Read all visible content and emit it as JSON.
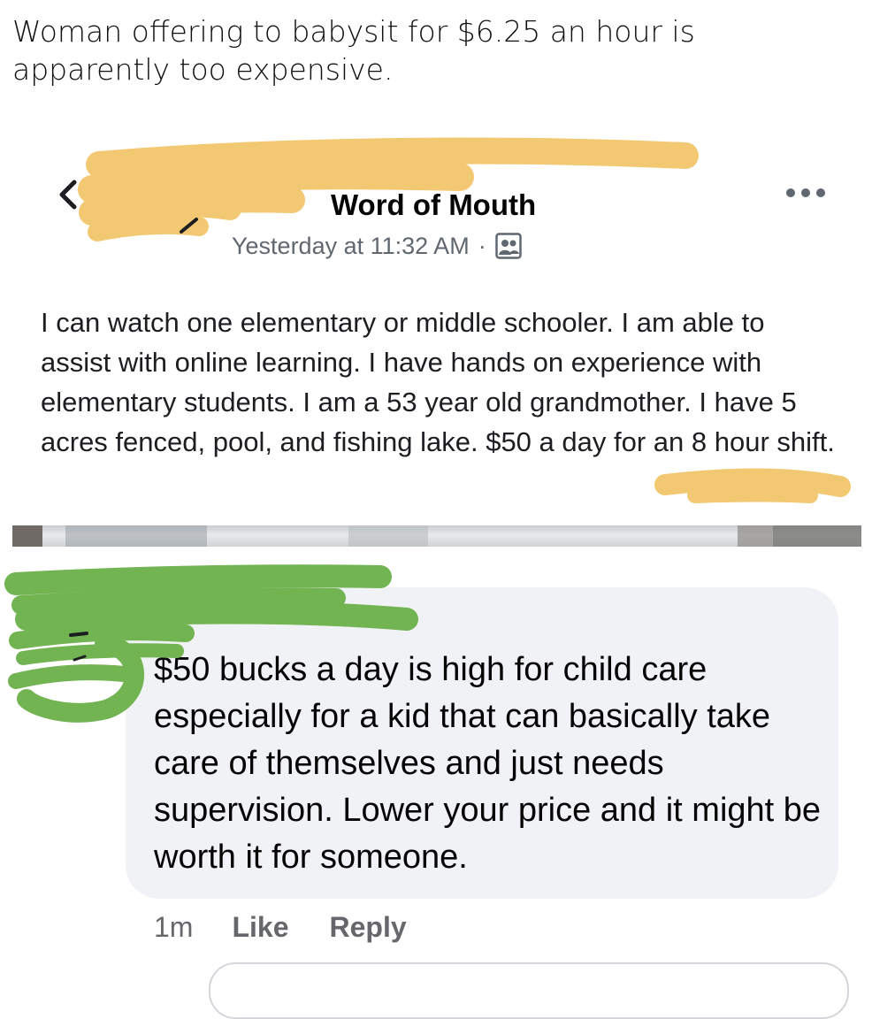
{
  "caption": "Woman offering to babysit for $6.25 an hour is apparently too expensive.",
  "post": {
    "group_name": "Word of Mouth",
    "timestamp": "Yesterday at 11:32 AM",
    "separator": "·",
    "body": "I can watch one elementary or middle schooler. I am able to assist with online learning. I have hands on experience with elementary students. I am a 53 year old grandmother. I have 5 acres fenced, pool, and fishing lake.  $50 a day for an 8 hour shift."
  },
  "comment": {
    "text": "$50 bucks a day is high for child care especially for a kid that can basically take care of themselves and just needs supervision. Lower your price and it might be worth it for someone.",
    "time": "1m",
    "like_label": "Like",
    "reply_label": "Reply"
  },
  "icons": {
    "back": "chevron-left-icon",
    "more": "more-options-icon",
    "audience": "group-members-icon"
  },
  "colors": {
    "redaction_orange": "#f3c872",
    "redaction_green": "#72b352",
    "comment_bubble": "#f0f2f5",
    "meta_text": "#606770"
  }
}
